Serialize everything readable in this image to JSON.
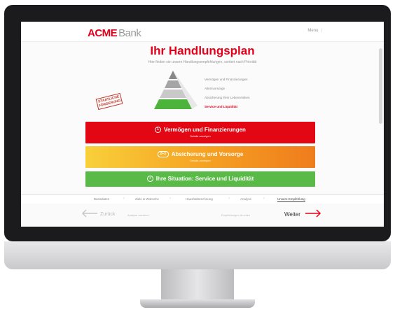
{
  "app": {
    "logo_brand": "ACME",
    "logo_suffix": "Bank",
    "menu_label": "Menu"
  },
  "page": {
    "title": "Ihr Handlungsplan",
    "subtitle": "Hier finden sie unsere Handlungsempfehlungen, sortiert nach Priorität"
  },
  "stamp": "STAATLICHE FÖRDERUNG",
  "pyramid_legend": [
    "Vermögen und Finanzierungen",
    "Altersvorsorge",
    "Absicherung Ihrer Lebensrisiken",
    "Service und Liquidität"
  ],
  "action_boxes": [
    {
      "title": "Vermögen und Finanzierungen",
      "sub": "Details anzeigen",
      "badge": "1"
    },
    {
      "title": "Absicherung und Vorsorge",
      "sub": "Details anzeigen",
      "badge": "2+3"
    },
    {
      "title": "Ihre Situation: Service und Liquidität",
      "badge": "i"
    }
  ],
  "steps": [
    "Basisdaten",
    "Ziele & Wünsche",
    "Haushaltsrechnung",
    "Analyse",
    "Unsere Empfehlung"
  ],
  "navigation": {
    "back_label": "Zurück",
    "left_link": "Analyse ansehen",
    "right_link": "Empfehlungen drucken",
    "next_label": "Weiter"
  },
  "colors": {
    "brand_red": "#e2001a",
    "priority_red": "#e30613",
    "priority_orange": "#f6a323",
    "priority_green": "#5aba47"
  }
}
